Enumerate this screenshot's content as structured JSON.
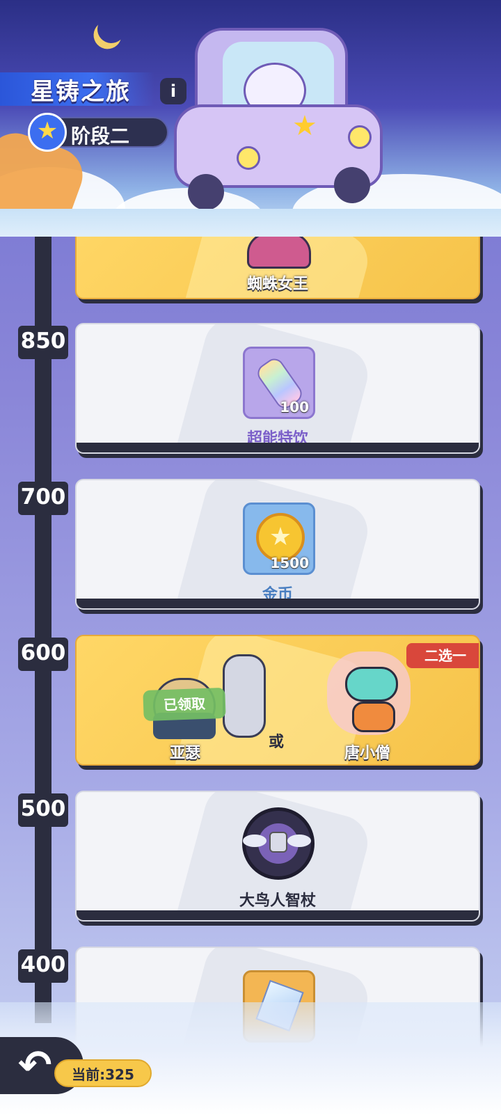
{
  "header": {
    "title": "星铸之旅",
    "info_label": "i",
    "stage_label": "阶段二"
  },
  "timeline": {
    "scores": [
      "850",
      "700",
      "600",
      "500",
      "400"
    ]
  },
  "rewards": {
    "spider_queen": {
      "name": "蜘蛛女王"
    },
    "drink": {
      "name": "超能特饮",
      "qty": "100",
      "icon": "rainbow-bottle"
    },
    "coins": {
      "name": "金币",
      "qty": "1500",
      "icon": "gold-coin",
      "coin_glyph": "★"
    },
    "choice": {
      "option_a": "亚瑟",
      "option_b": "唐小僧",
      "or_label": "或",
      "claimed_label": "已领取",
      "badge_label": "二选一"
    },
    "staff": {
      "name": "大鸟人智杖",
      "icon": "locked-staff-emblem"
    },
    "crystal": {
      "icon": "crystal-gem"
    }
  },
  "footer": {
    "back_icon": "↶",
    "current_label": "当前:325"
  },
  "colors": {
    "accent_gold": "#f7c84a",
    "dark": "#2b2d3f",
    "badge_red": "#d9473b",
    "drink_name": "#7b5fc9",
    "coin_name": "#4a7fc1"
  }
}
